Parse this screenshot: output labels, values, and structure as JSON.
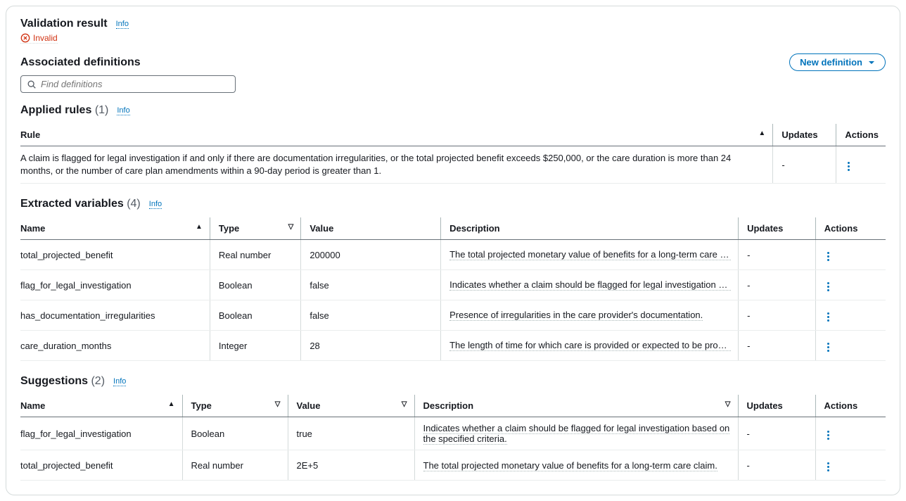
{
  "validation": {
    "title": "Validation result",
    "info": "Info",
    "status": "Invalid"
  },
  "associated": {
    "title": "Associated definitions",
    "new_btn": "New definition",
    "search_placeholder": "Find definitions"
  },
  "applied_rules": {
    "title": "Applied rules",
    "count": "(1)",
    "info": "Info",
    "columns": {
      "rule": "Rule",
      "updates": "Updates",
      "actions": "Actions"
    },
    "rows": [
      {
        "rule": "A claim is flagged for legal investigation if and only if there are documentation irregularities, or the total projected benefit exceeds $250,000, or the care duration is more than 24 months, or the number of care plan amendments within a 90-day period is greater than 1.",
        "updates": "-"
      }
    ]
  },
  "extracted": {
    "title": "Extracted variables",
    "count": "(4)",
    "info": "Info",
    "columns": {
      "name": "Name",
      "type": "Type",
      "value": "Value",
      "description": "Description",
      "updates": "Updates",
      "actions": "Actions"
    },
    "rows": [
      {
        "name": "total_projected_benefit",
        "type": "Real number",
        "value": "200000",
        "description": "The total projected monetary value of benefits for a long-term care claim.",
        "updates": "-"
      },
      {
        "name": "flag_for_legal_investigation",
        "type": "Boolean",
        "value": "false",
        "description": "Indicates whether a claim should be flagged for legal investigation based on the specified crite…",
        "updates": "-"
      },
      {
        "name": "has_documentation_irregularities",
        "type": "Boolean",
        "value": "false",
        "description": "Presence of irregularities in the care provider's documentation.",
        "updates": "-"
      },
      {
        "name": "care_duration_months",
        "type": "Integer",
        "value": "28",
        "description": "The length of time for which care is provided or expected to be provided.",
        "updates": "-"
      }
    ]
  },
  "suggestions": {
    "title": "Suggestions",
    "count": "(2)",
    "info": "Info",
    "columns": {
      "name": "Name",
      "type": "Type",
      "value": "Value",
      "description": "Description",
      "updates": "Updates",
      "actions": "Actions"
    },
    "rows": [
      {
        "name": "flag_for_legal_investigation",
        "type": "Boolean",
        "value": "true",
        "description": "Indicates whether a claim should be flagged for legal investigation based on the specified criteria.",
        "updates": "-"
      },
      {
        "name": "total_projected_benefit",
        "type": "Real number",
        "value": "2E+5",
        "description": "The total projected monetary value of benefits for a long-term care claim.",
        "updates": "-"
      }
    ]
  }
}
